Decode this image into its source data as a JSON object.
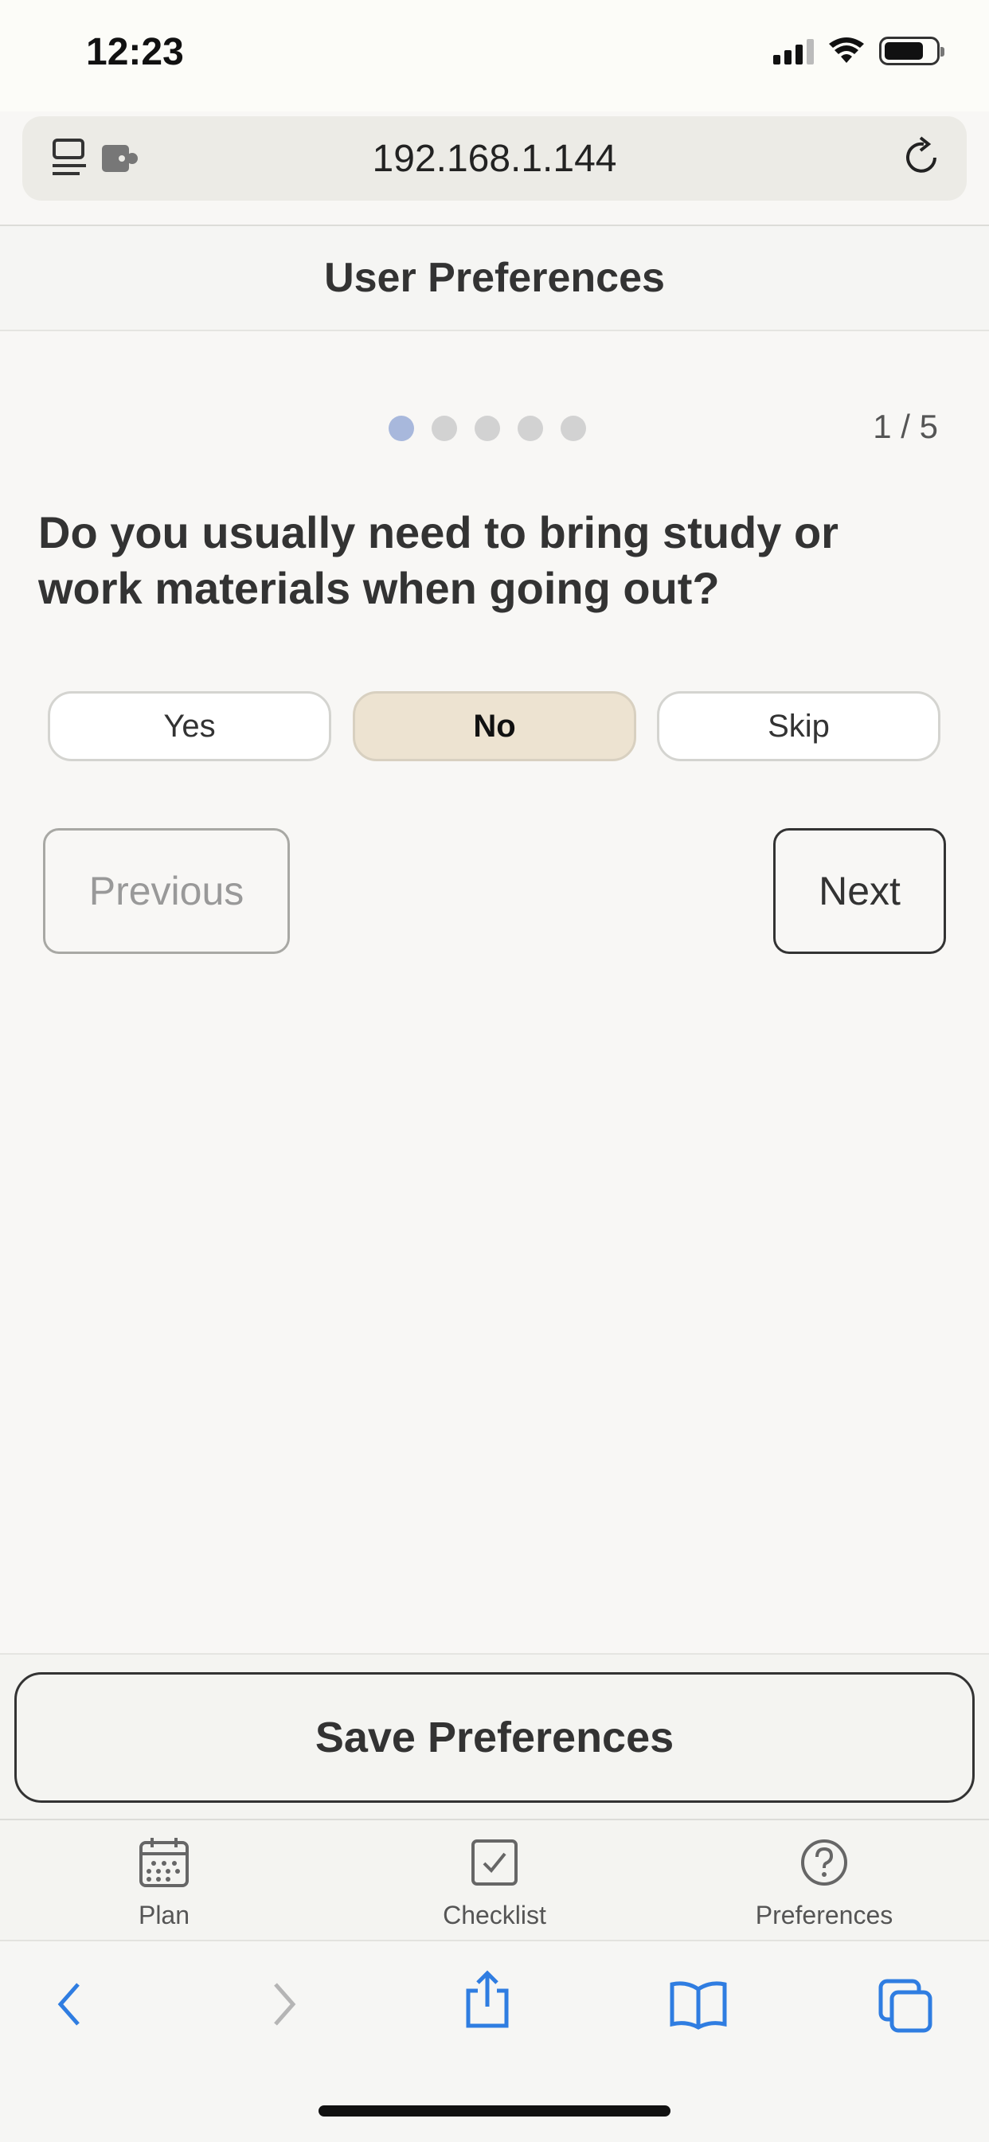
{
  "status_bar": {
    "time": "12:23"
  },
  "browser": {
    "url": "192.168.1.144"
  },
  "header": {
    "title": "User Preferences"
  },
  "progress": {
    "current": 1,
    "total": 5,
    "label": "1 / 5"
  },
  "question": {
    "text": "Do you usually need to bring study or work materials when going out?"
  },
  "answers": [
    {
      "label": "Yes",
      "selected": false
    },
    {
      "label": "No",
      "selected": true
    },
    {
      "label": "Skip",
      "selected": false
    }
  ],
  "navigation": {
    "previous_label": "Previous",
    "next_label": "Next"
  },
  "save": {
    "label": "Save Preferences"
  },
  "tabs": [
    {
      "label": "Plan",
      "icon": "calendar-icon"
    },
    {
      "label": "Checklist",
      "icon": "checkbox-icon"
    },
    {
      "label": "Preferences",
      "icon": "question-circle-icon"
    }
  ],
  "colors": {
    "accent_link": "#2f7de1",
    "selected_answer": "#ede3d1",
    "active_dot": "#a8b8dc"
  }
}
